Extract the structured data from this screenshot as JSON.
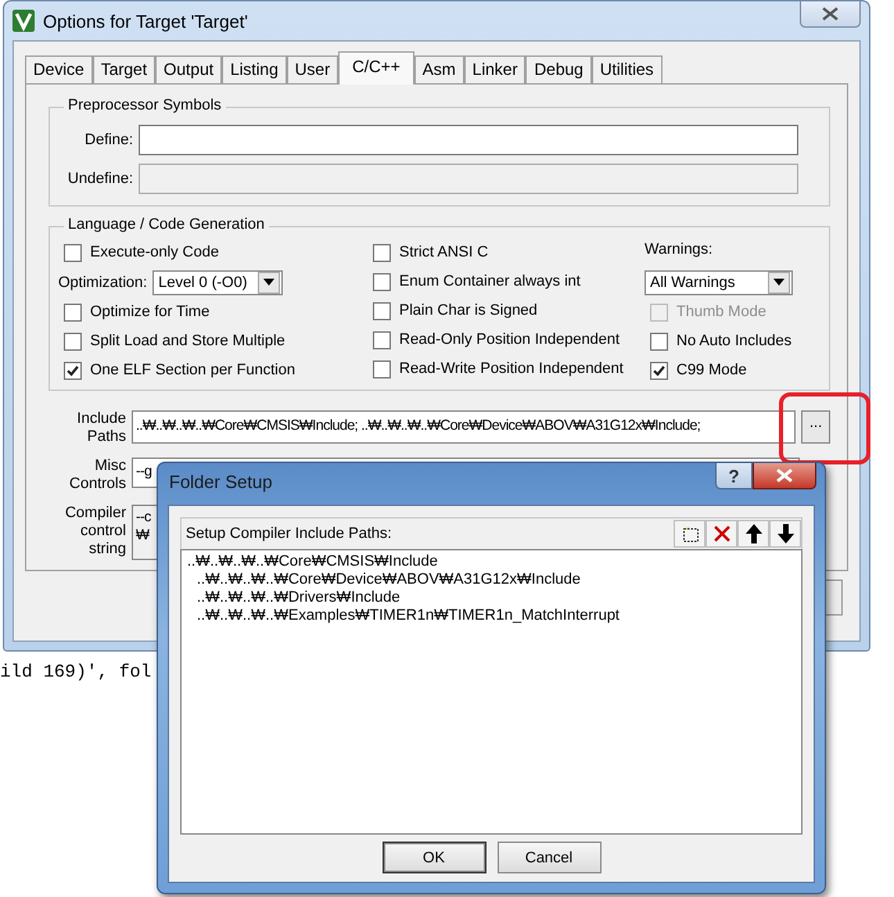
{
  "main_window": {
    "title": "Options for Target 'Target'",
    "tabs": [
      {
        "label": "Device",
        "selected": false
      },
      {
        "label": "Target",
        "selected": false
      },
      {
        "label": "Output",
        "selected": false
      },
      {
        "label": "Listing",
        "selected": false
      },
      {
        "label": "User",
        "selected": false
      },
      {
        "label": "C/C++",
        "selected": true
      },
      {
        "label": "Asm",
        "selected": false
      },
      {
        "label": "Linker",
        "selected": false
      },
      {
        "label": "Debug",
        "selected": false
      },
      {
        "label": "Utilities",
        "selected": false
      }
    ],
    "preprocessor": {
      "title": "Preprocessor Symbols",
      "fields": [
        {
          "label": "Define:",
          "disabled": false
        },
        {
          "label": "Undefine:",
          "disabled": true
        }
      ]
    },
    "language": {
      "title": "Language / Code Generation",
      "columns": [
        [
          {
            "kind": "checkbox",
            "label": "Execute-only Code",
            "checked": false,
            "disabled": false
          },
          {
            "kind": "select",
            "label": "Optimization:",
            "value": "Level 0 (-O0)"
          },
          {
            "kind": "checkbox",
            "label": "Optimize for Time",
            "checked": false,
            "disabled": false
          },
          {
            "kind": "checkbox",
            "label": "Split Load and Store Multiple",
            "checked": false,
            "disabled": false
          },
          {
            "kind": "checkbox",
            "label": "One ELF Section per Function",
            "checked": true,
            "disabled": false
          }
        ],
        [
          {
            "kind": "checkbox",
            "label": "Strict ANSI C",
            "checked": false,
            "disabled": false
          },
          {
            "kind": "checkbox",
            "label": "Enum Container always int",
            "checked": false,
            "disabled": false
          },
          {
            "kind": "checkbox",
            "label": "Plain Char is Signed",
            "checked": false,
            "disabled": false
          },
          {
            "kind": "checkbox",
            "label": "Read-Only Position Independent",
            "checked": false,
            "disabled": false
          },
          {
            "kind": "checkbox",
            "label": "Read-Write Position Independent",
            "checked": false,
            "disabled": false
          }
        ],
        [
          {
            "kind": "label",
            "label": "Warnings:"
          },
          {
            "kind": "select",
            "value": "All Warnings"
          },
          {
            "kind": "checkbox",
            "label": "Thumb Mode",
            "checked": false,
            "disabled": true
          },
          {
            "kind": "checkbox",
            "label": "No Auto Includes",
            "checked": false,
            "disabled": false
          },
          {
            "kind": "checkbox",
            "label": "C99 Mode",
            "checked": true,
            "disabled": false
          }
        ]
      ]
    },
    "include_paths": {
      "label": "Include Paths",
      "value": "..₩..₩..₩..₩Core₩CMSIS₩Include;  ..₩..₩..₩..₩Core₩Device₩ABOV₩A31G12x₩Include;",
      "browse_button": "..."
    },
    "misc_controls": {
      "label": "Misc Controls",
      "value": "--g"
    },
    "compiler_control": {
      "label": "Compiler control string",
      "lines": [
        "--c",
        "₩"
      ]
    }
  },
  "background_text": "ild 169)', fol",
  "folder_setup": {
    "title": "Folder Setup",
    "help_button": "?",
    "header": "Setup Compiler Include Paths:",
    "paths": [
      "..₩..₩..₩..₩Core₩CMSIS₩Include",
      "..₩..₩..₩..₩Core₩Device₩ABOV₩A31G12x₩Include",
      "..₩..₩..₩..₩Drivers₩Include",
      "..₩..₩..₩..₩Examples₩TIMER1n₩TIMER1n_MatchInterrupt"
    ],
    "buttons": [
      "OK",
      "Cancel"
    ]
  }
}
